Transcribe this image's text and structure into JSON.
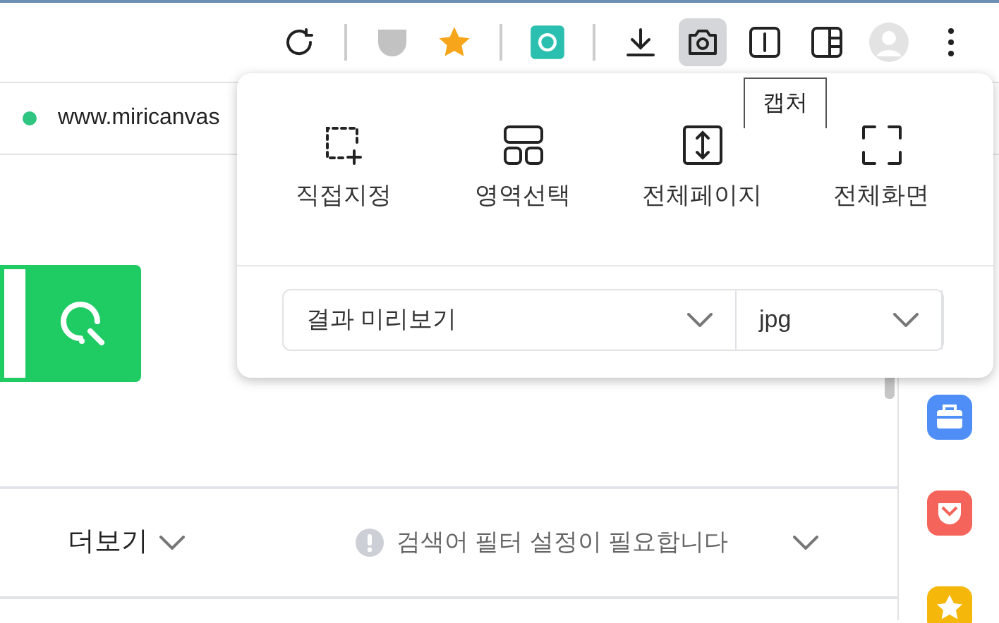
{
  "toolbar": {
    "buttons": [
      {
        "kind": "reload",
        "selected": false
      },
      {
        "kind": "sep"
      },
      {
        "kind": "pocket",
        "selected": false
      },
      {
        "kind": "star",
        "selected": false
      },
      {
        "kind": "sep"
      },
      {
        "kind": "ext",
        "selected": false
      },
      {
        "kind": "sep"
      },
      {
        "kind": "download",
        "selected": false
      },
      {
        "kind": "camera",
        "selected": true
      },
      {
        "kind": "reader",
        "selected": false
      },
      {
        "kind": "sidebar",
        "selected": false
      },
      {
        "kind": "avatar",
        "selected": false
      },
      {
        "kind": "menu",
        "selected": false
      }
    ]
  },
  "address_bar": {
    "url": "www.miricanvas"
  },
  "capture_popup": {
    "tooltip": "캡처",
    "modes": [
      {
        "kind": "custom",
        "label": "직접지정"
      },
      {
        "kind": "area",
        "label": "영역선택"
      },
      {
        "kind": "page",
        "label": "전체페이지"
      },
      {
        "kind": "screen",
        "label": "전체화면"
      }
    ],
    "selects": [
      {
        "value": "결과 미리보기"
      },
      {
        "value": "jpg"
      }
    ]
  },
  "filter_bar": {
    "more": "더보기",
    "notice": "검색어 필터 설정이 필요합니다"
  },
  "sidebar": {
    "icons": [
      {
        "kind": "briefcase",
        "color": "#4f8ef7"
      },
      {
        "kind": "pocket",
        "color": "#f5645a"
      },
      {
        "kind": "star",
        "color": "#f5b70a"
      }
    ]
  }
}
